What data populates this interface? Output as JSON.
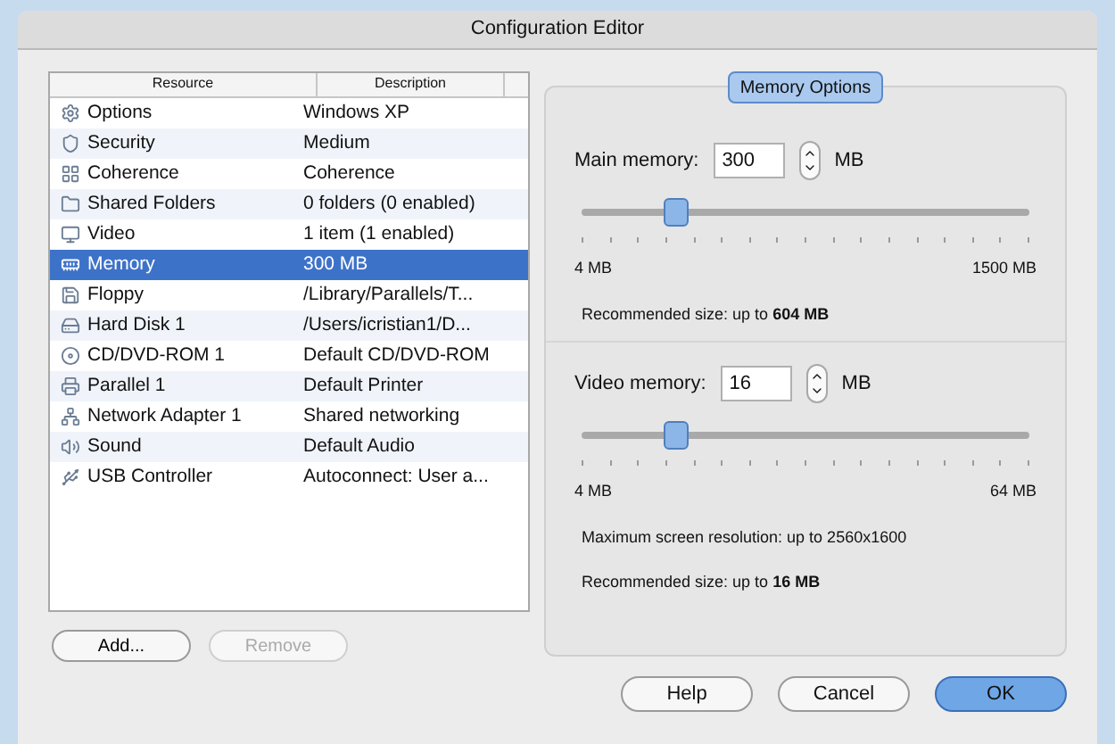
{
  "window": {
    "title": "Configuration Editor"
  },
  "table": {
    "columns": [
      "Resource",
      "Description"
    ],
    "rows": [
      {
        "resource": "Options",
        "description": "Windows XP",
        "selected": false
      },
      {
        "resource": "Security",
        "description": "Medium",
        "selected": false
      },
      {
        "resource": "Coherence",
        "description": "Coherence",
        "selected": false
      },
      {
        "resource": "Shared Folders",
        "description": "0 folders (0 enabled)",
        "selected": false
      },
      {
        "resource": "Video",
        "description": "1 item (1 enabled)",
        "selected": false
      },
      {
        "resource": "Memory",
        "description": "300 MB",
        "selected": true
      },
      {
        "resource": "Floppy",
        "description": "/Library/Parallels/T...",
        "selected": false
      },
      {
        "resource": "Hard Disk 1",
        "description": "/Users/icristian1/D...",
        "selected": false
      },
      {
        "resource": "CD/DVD-ROM 1",
        "description": "Default CD/DVD-ROM",
        "selected": false
      },
      {
        "resource": "Parallel 1",
        "description": "Default Printer",
        "selected": false
      },
      {
        "resource": "Network Adapter 1",
        "description": "Shared networking",
        "selected": false
      },
      {
        "resource": "Sound",
        "description": "Default Audio",
        "selected": false
      },
      {
        "resource": "USB Controller",
        "description": "Autoconnect: User a...",
        "selected": false
      }
    ]
  },
  "list_buttons": [
    {
      "label": "Add...",
      "disabled": false
    },
    {
      "label": "Remove",
      "disabled": true
    }
  ],
  "panel": {
    "tab": "Memory Options",
    "main_memory": {
      "label": "Main memory:",
      "value": "300",
      "unit": "MB",
      "level": 0.21,
      "min": "4 MB",
      "max": "1500 MB",
      "notes": [
        "Recommended size: up to **604 MB**"
      ]
    },
    "video_memory": {
      "label": "Video memory:",
      "value": "16",
      "unit": "MB",
      "level": 0.21,
      "min": "4 MB",
      "max": "64 MB",
      "notes": [
        "Maximum screen resolution: up to 2560x1600",
        "Recommended size: up to **16 MB**"
      ]
    }
  },
  "buttons": [
    {
      "label": "Help",
      "default": false
    },
    {
      "label": "Cancel",
      "default": false
    },
    {
      "label": "OK",
      "default": true
    }
  ]
}
